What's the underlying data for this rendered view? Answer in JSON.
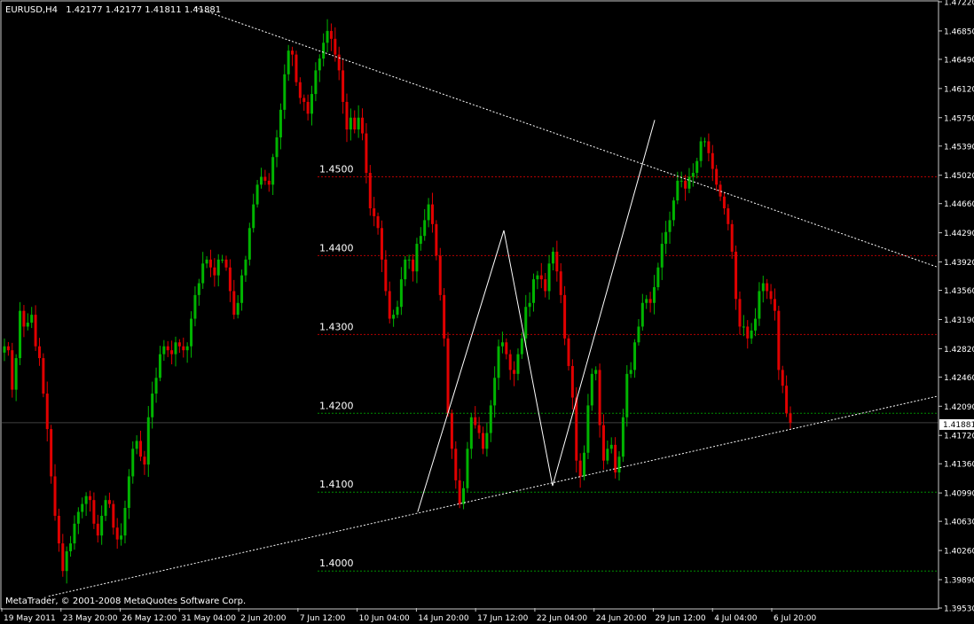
{
  "header": {
    "symbol": "EURUSD,H4",
    "ohlc": "1.42177 1.42177 1.41811 1.41881"
  },
  "footer": {
    "copyright": "MetaTrader, © 2001-2008 MetaQuotes Software Corp."
  },
  "colors": {
    "background": "#000000",
    "frame": "#c8c8c8",
    "text": "#ffffff",
    "bull": "#00b400",
    "bear": "#e00000",
    "trendline": "#ffffff",
    "level_above": "#b40000",
    "level_below": "#008c00",
    "price_tag_bg": "#ffffff",
    "price_tag_text": "#000000"
  },
  "chart_data": {
    "type": "candlestick",
    "symbol": "EURUSD",
    "timeframe": "H4",
    "ylim": [
      1.3953,
      1.4722
    ],
    "current_price": "1.41881",
    "price_ticks": [
      "1.47220",
      "1.46850",
      "1.46490",
      "1.46120",
      "1.45750",
      "1.45390",
      "1.45020",
      "1.44660",
      "1.44290",
      "1.43920",
      "1.43560",
      "1.43190",
      "1.42820",
      "1.42460",
      "1.42090",
      "1.41720",
      "1.41360",
      "1.40990",
      "1.40630",
      "1.40260",
      "1.39890",
      "1.39530"
    ],
    "time_ticks": [
      "19 May 2011",
      "23 May 20:00",
      "26 May 12:00",
      "31 May 04:00",
      "2 Jun 20:00",
      "7 Jun 12:00",
      "10 Jun 04:00",
      "14 Jun 20:00",
      "17 Jun 12:00",
      "22 Jun 04:00",
      "24 Jun 20:00",
      "29 Jun 12:00",
      "4 Jul 04:00",
      "6 Jul 20:00"
    ],
    "levels": [
      {
        "label": "1.4500",
        "value": 1.45,
        "style": "above"
      },
      {
        "label": "1.4400",
        "value": 1.44,
        "style": "above"
      },
      {
        "label": "1.4300",
        "value": 1.43,
        "style": "above"
      },
      {
        "label": "1.4200",
        "value": 1.42,
        "style": "below"
      },
      {
        "label": "1.4100",
        "value": 1.41,
        "style": "below"
      },
      {
        "label": "1.4000",
        "value": 1.4,
        "style": "below"
      }
    ],
    "trendlines": [
      {
        "name": "upper-trendline",
        "from": [
          0.206,
          1.4715
        ],
        "to": [
          1.0,
          1.4385
        ],
        "style": "dotted"
      },
      {
        "name": "lower-trendline",
        "from": [
          0.05,
          1.3968
        ],
        "to": [
          1.0,
          1.4222
        ],
        "style": "dotted"
      }
    ],
    "zigzag": [
      [
        0.444,
        1.4075
      ],
      [
        0.536,
        1.4432
      ],
      [
        0.588,
        1.4108
      ],
      [
        0.697,
        1.4572
      ]
    ],
    "closes": [
      1.4285,
      1.428,
      1.423,
      1.427,
      1.433,
      1.431,
      1.4315,
      1.4325,
      1.4285,
      1.427,
      1.4225,
      1.418,
      1.412,
      1.407,
      1.4035,
      1.4,
      1.4025,
      1.4035,
      1.406,
      1.4075,
      1.4085,
      1.4095,
      1.409,
      1.406,
      1.4045,
      1.407,
      1.409,
      1.4085,
      1.4055,
      1.404,
      1.4045,
      1.408,
      1.412,
      1.4155,
      1.4165,
      1.4145,
      1.4135,
      1.4195,
      1.4225,
      1.4245,
      1.4275,
      1.4285,
      1.428,
      1.4275,
      1.429,
      1.4285,
      1.428,
      1.4285,
      1.432,
      1.435,
      1.4365,
      1.439,
      1.4395,
      1.4385,
      1.4375,
      1.4395,
      1.4395,
      1.4385,
      1.4355,
      1.4325,
      1.434,
      1.4375,
      1.4395,
      1.4435,
      1.4465,
      1.449,
      1.45,
      1.4495,
      1.449,
      1.4525,
      1.455,
      1.4585,
      1.463,
      1.466,
      1.4655,
      1.462,
      1.46,
      1.4595,
      1.458,
      1.4605,
      1.4635,
      1.465,
      1.467,
      1.4685,
      1.4675,
      1.4655,
      1.4635,
      1.4595,
      1.456,
      1.4575,
      1.456,
      1.4575,
      1.4555,
      1.4505,
      1.446,
      1.445,
      1.4435,
      1.4395,
      1.4355,
      1.432,
      1.4325,
      1.4335,
      1.437,
      1.4395,
      1.4395,
      1.438,
      1.4415,
      1.4425,
      1.4445,
      1.4465,
      1.444,
      1.44,
      1.435,
      1.4295,
      1.42,
      1.4155,
      1.4115,
      1.4085,
      1.4105,
      1.4155,
      1.4195,
      1.4185,
      1.4175,
      1.4155,
      1.4175,
      1.421,
      1.4245,
      1.4285,
      1.429,
      1.4275,
      1.4255,
      1.425,
      1.4275,
      1.4295,
      1.4335,
      1.434,
      1.437,
      1.4375,
      1.437,
      1.4355,
      1.439,
      1.4405,
      1.438,
      1.435,
      1.4295,
      1.426,
      1.422,
      1.414,
      1.412,
      1.415,
      1.421,
      1.425,
      1.4255,
      1.4185,
      1.414,
      1.4155,
      1.416,
      1.4125,
      1.4145,
      1.4195,
      1.425,
      1.4255,
      1.429,
      1.431,
      1.434,
      1.4345,
      1.434,
      1.436,
      1.4385,
      1.4415,
      1.443,
      1.4445,
      1.447,
      1.4495,
      1.4495,
      1.4485,
      1.45,
      1.4505,
      1.452,
      1.4545,
      1.4545,
      1.453,
      1.451,
      1.449,
      1.4475,
      1.446,
      1.444,
      1.4405,
      1.4345,
      1.431,
      1.431,
      1.4295,
      1.4305,
      1.432,
      1.4355,
      1.4365,
      1.4355,
      1.4345,
      1.433,
      1.4255,
      1.4235,
      1.42,
      1.4188
    ]
  }
}
